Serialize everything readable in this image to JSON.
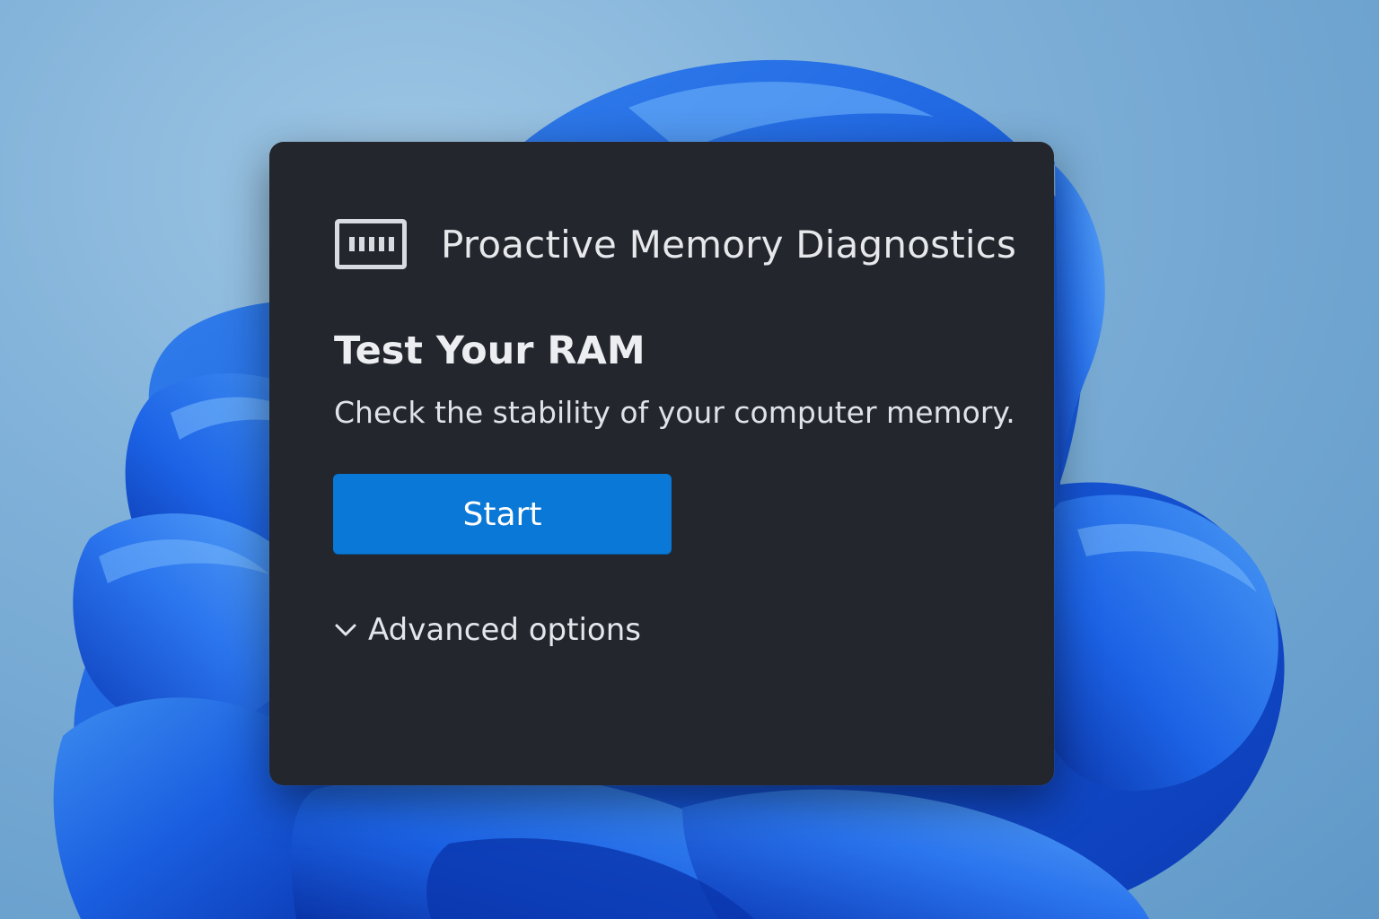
{
  "dialog": {
    "app_icon": "memory-module-icon",
    "title": "Proactive Memory Diagnostics",
    "section_title": "Test Your RAM",
    "description": "Check the stability of your computer memory.",
    "start_button_label": "Start",
    "advanced_icon": "chevron-down-icon",
    "advanced_label": "Advanced options"
  },
  "colors": {
    "dialog_background": "#23262c",
    "accent": "#0a78d7",
    "text": "#e6e8ec",
    "wallpaper_sky": "#7fb0d8",
    "wallpaper_bloom": "#1a5fe0"
  }
}
